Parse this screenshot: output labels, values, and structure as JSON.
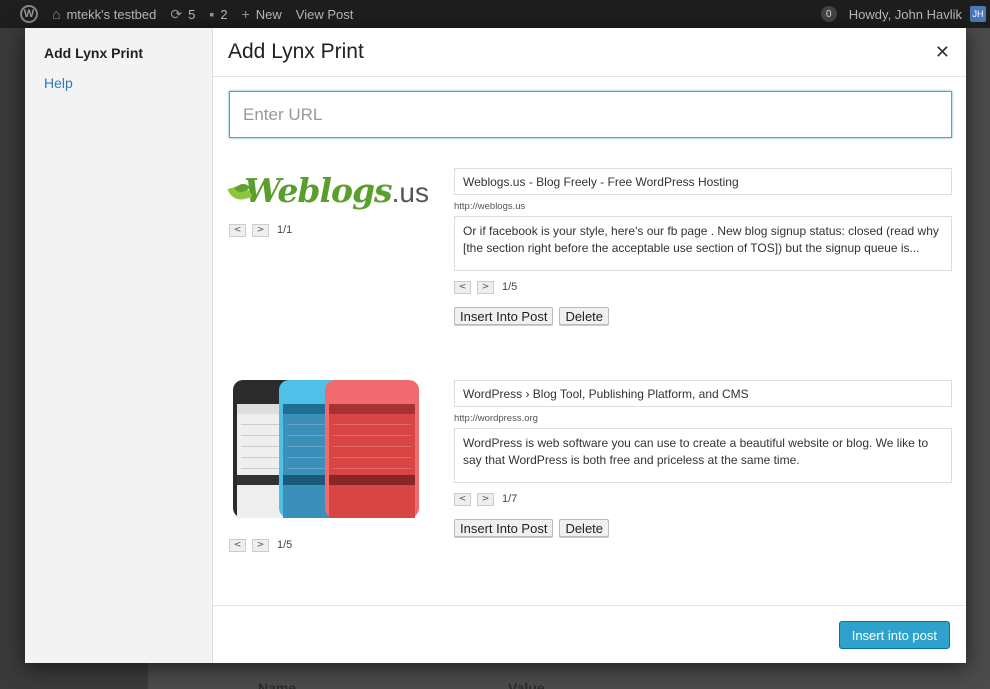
{
  "adminbar": {
    "site_name": "mtekk's testbed",
    "updates_count": "5",
    "comments_count": "2",
    "new_label": "New",
    "view_post_label": "View Post",
    "notification_count": "0",
    "howdy": "Howdy, John Havlik"
  },
  "background": {
    "col_name": "Name",
    "col_value": "Value"
  },
  "modal": {
    "sidebar": {
      "active_item": "Add Lynx Print",
      "help_link": "Help"
    },
    "title": "Add Lynx Print",
    "close_icon": "close-icon",
    "url_placeholder": "Enter URL",
    "prints": [
      {
        "image_counter": "1/1",
        "title": "Weblogs.us - Blog Freely - Free WordPress Hosting",
        "url": "http://weblogs.us",
        "description": "Or if facebook is your style, here's our fb page . New blog signup status: closed (read why [the section right before the acceptable use section of TOS]) but the signup queue is...",
        "desc_counter": "1/5",
        "insert_label": "Insert Into Post",
        "delete_label": "Delete",
        "logo_main": "Weblogs",
        "logo_tld": ".us"
      },
      {
        "image_counter": "1/5",
        "title": "WordPress › Blog Tool, Publishing Platform, and CMS",
        "url": "http://wordpress.org",
        "description": "WordPress is web software you can use to create a beautiful website or blog. We like to say that WordPress is both free and priceless at the same time.",
        "desc_counter": "1/7",
        "insert_label": "Insert Into Post",
        "delete_label": "Delete"
      }
    ],
    "prev_glyph": "<",
    "next_glyph": ">",
    "footer_button": "Insert into post"
  },
  "colors": {
    "primary_button": "#2ea2cc",
    "link": "#2a7bb6",
    "adminbar": "#1e1e1e"
  }
}
